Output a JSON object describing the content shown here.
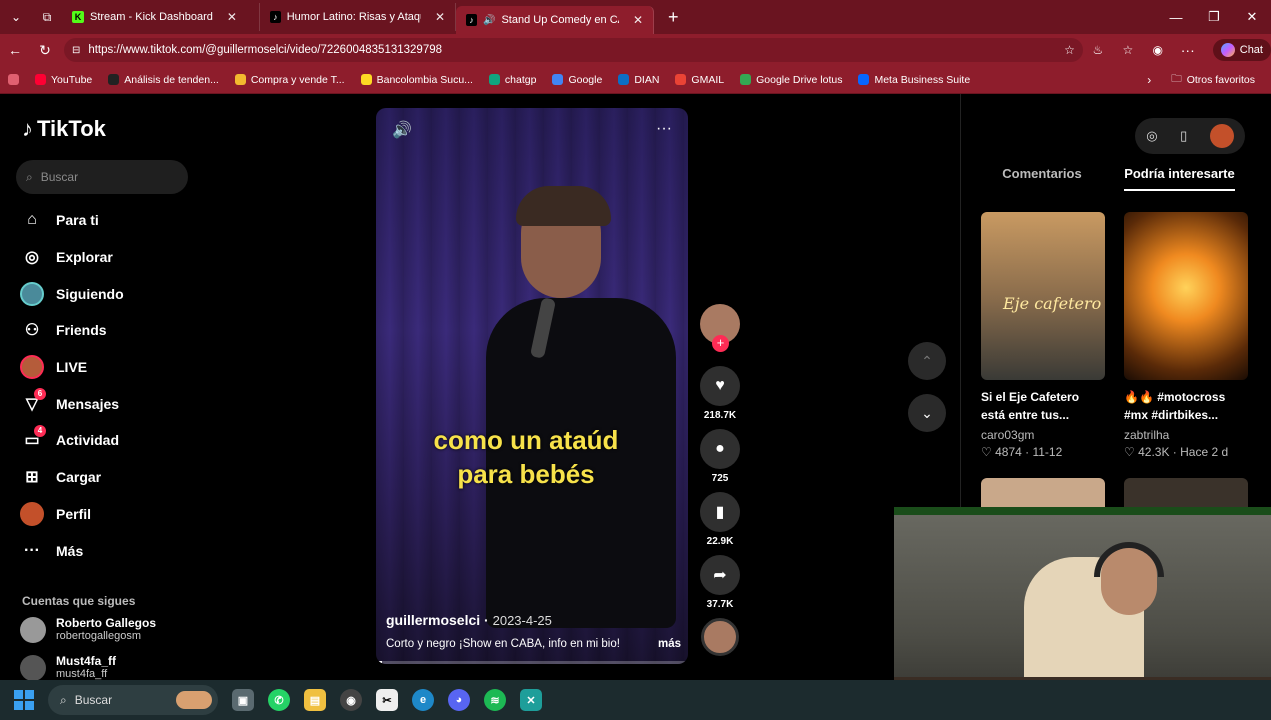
{
  "browser": {
    "tabs": [
      {
        "label": "Stream - Kick Dashboard",
        "icon": "kick-icon",
        "color": "#53fc18"
      },
      {
        "label": "Humor Latino: Risas y Ataques Esp",
        "icon": "tiktok-icon",
        "color": "#000000"
      },
      {
        "label": "Stand Up Comedy en CABA: S",
        "icon": "tiktok-icon",
        "color": "#000000",
        "active": true
      }
    ],
    "new_tab": "+",
    "url": "https://www.tiktok.com/@guillermoselci/video/7226004835131329798",
    "chat_label": "Chat",
    "bookmarks": [
      {
        "label": "YouTube",
        "color": "#ff0033"
      },
      {
        "label": "Análisis de tenden...",
        "color": "#222222"
      },
      {
        "label": "Compra y vende T...",
        "color": "#f3ba2f"
      },
      {
        "label": "Bancolombia Sucu...",
        "color": "#fdda24"
      },
      {
        "label": "chatgp",
        "color": "#10a37f"
      },
      {
        "label": "Google",
        "color": "#4285f4"
      },
      {
        "label": "DIAN",
        "color": "#0b6ec5"
      },
      {
        "label": "GMAIL",
        "color": "#ea4335"
      },
      {
        "label": "Google Drive lotus",
        "color": "#34a853"
      },
      {
        "label": "Meta Business Suite",
        "color": "#0866ff"
      }
    ],
    "other_bookmarks": "Otros favoritos"
  },
  "tiktok": {
    "logo": "TikTok",
    "search_placeholder": "Buscar",
    "menu": [
      {
        "label": "Para ti",
        "icon": "home-icon",
        "glyph": "⌂"
      },
      {
        "label": "Explorar",
        "icon": "compass-icon",
        "glyph": "◎"
      },
      {
        "label": "Siguiendo",
        "icon": "following-avatar-icon",
        "glyph": ""
      },
      {
        "label": "Friends",
        "icon": "friends-icon",
        "glyph": "⚇"
      },
      {
        "label": "LIVE",
        "icon": "live-avatar-icon",
        "glyph": ""
      },
      {
        "label": "Mensajes",
        "icon": "messages-icon",
        "glyph": "▽",
        "badge": "6"
      },
      {
        "label": "Actividad",
        "icon": "activity-icon",
        "glyph": "▭",
        "badge": "4"
      },
      {
        "label": "Cargar",
        "icon": "upload-icon",
        "glyph": "⊞"
      },
      {
        "label": "Perfil",
        "icon": "profile-avatar-icon",
        "glyph": ""
      },
      {
        "label": "Más",
        "icon": "more-icon",
        "glyph": "···"
      }
    ],
    "following_title": "Cuentas que sigues",
    "following": [
      {
        "name": "Roberto Gallegos",
        "user": "robertogallegosm"
      },
      {
        "name": "Must4fa_ff",
        "user": "must4fa_ff"
      }
    ],
    "video": {
      "caption": "como un ataúd para bebés",
      "username": "guillermoselci",
      "date": "2023-4-25",
      "description": "Corto y negro ¡Show en CABA, info en mi bio!",
      "more": "más",
      "progress": 0.02
    },
    "actions": {
      "likes": "218.7K",
      "comments": "725",
      "saves": "22.9K",
      "shares": "37.7K"
    },
    "right_tabs": [
      "Comentarios",
      "Podría interesarte"
    ],
    "cards": [
      {
        "title": "Si el Eje Cafetero está entre tus...",
        "user": "caro03gm",
        "stats": "♡ 4874 · 11-12"
      },
      {
        "title": "🔥🔥 #motocross #mx #dirtbikes...",
        "user": "zabtrilha",
        "stats": "♡ 42.3K · Hace 2 d"
      }
    ],
    "thumb_text": "Eje cafetero"
  },
  "taskbar": {
    "search": "Buscar"
  }
}
